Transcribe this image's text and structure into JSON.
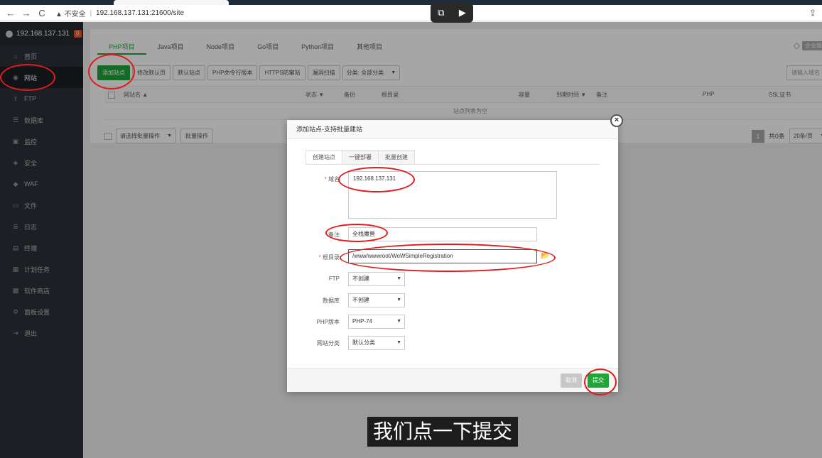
{
  "browser": {
    "security_label": "▲ 不安全",
    "url": "192.168.137.131:21600/site"
  },
  "sidebar": {
    "host": "192.168.137.131",
    "badge": "0",
    "items": [
      {
        "label": "首页",
        "icon": "home-icon",
        "glyph": "⌂"
      },
      {
        "label": "网站",
        "icon": "globe-icon",
        "glyph": "◉"
      },
      {
        "label": "FTP",
        "icon": "ftp-icon",
        "glyph": "⇪"
      },
      {
        "label": "数据库",
        "icon": "database-icon",
        "glyph": "☰"
      },
      {
        "label": "监控",
        "icon": "monitor-icon",
        "glyph": "▣"
      },
      {
        "label": "安全",
        "icon": "shield-icon",
        "glyph": "◈"
      },
      {
        "label": "WAF",
        "icon": "waf-icon",
        "glyph": "◆"
      },
      {
        "label": "文件",
        "icon": "folder-icon",
        "glyph": "▭"
      },
      {
        "label": "日志",
        "icon": "log-icon",
        "glyph": "≣"
      },
      {
        "label": "终端",
        "icon": "terminal-icon",
        "glyph": "▤"
      },
      {
        "label": "计划任务",
        "icon": "calendar-icon",
        "glyph": "▦"
      },
      {
        "label": "软件商店",
        "icon": "apps-icon",
        "glyph": "▩"
      },
      {
        "label": "面板设置",
        "icon": "gear-icon",
        "glyph": "⚙"
      },
      {
        "label": "退出",
        "icon": "logout-icon",
        "glyph": "⇥"
      }
    ]
  },
  "tabs": [
    "PHP项目",
    "Java项目",
    "Node项目",
    "Go项目",
    "Python项目",
    "其他项目"
  ],
  "vip_label": "企业版",
  "toolbar": {
    "add_site": "添加站点",
    "buttons": [
      "修改默认页",
      "默认站点",
      "PHP命令行版本",
      "HTTPS防窜站",
      "漏洞扫描"
    ],
    "category": "分类: 全部分类",
    "search_placeholder": "请输入域名"
  },
  "table": {
    "headers": [
      "网站名 ▲",
      "状态 ▼",
      "备份",
      "根目录",
      "容量",
      "到期时间 ▼",
      "备注",
      "PHP",
      "SSL证书"
    ],
    "empty": "站点列表为空",
    "batch_select": "请选择批量操作",
    "batch_button": "批量操作"
  },
  "pager": {
    "page": "1",
    "total": "共0条",
    "per_page": "20条/页"
  },
  "modal": {
    "title": "添加站点-支持批量建站",
    "tabs": [
      "创建站点",
      "一键部署",
      "批量创建"
    ],
    "domain_label": "域名",
    "domain_value": "192.168.137.131",
    "remark_label": "备注",
    "remark_value": "全栈魔兽",
    "root_label": "根目录",
    "root_value": "/www/wwwroot/WoWSimpleRegistration",
    "ftp_label": "FTP",
    "ftp_value": "不创建",
    "db_label": "数据库",
    "db_value": "不创建",
    "php_label": "PHP版本",
    "php_value": "PHP-74",
    "cat_label": "网站分类",
    "cat_value": "默认分类",
    "cancel": "取消",
    "submit": "提交"
  },
  "subtitle": "我们点一下提交"
}
